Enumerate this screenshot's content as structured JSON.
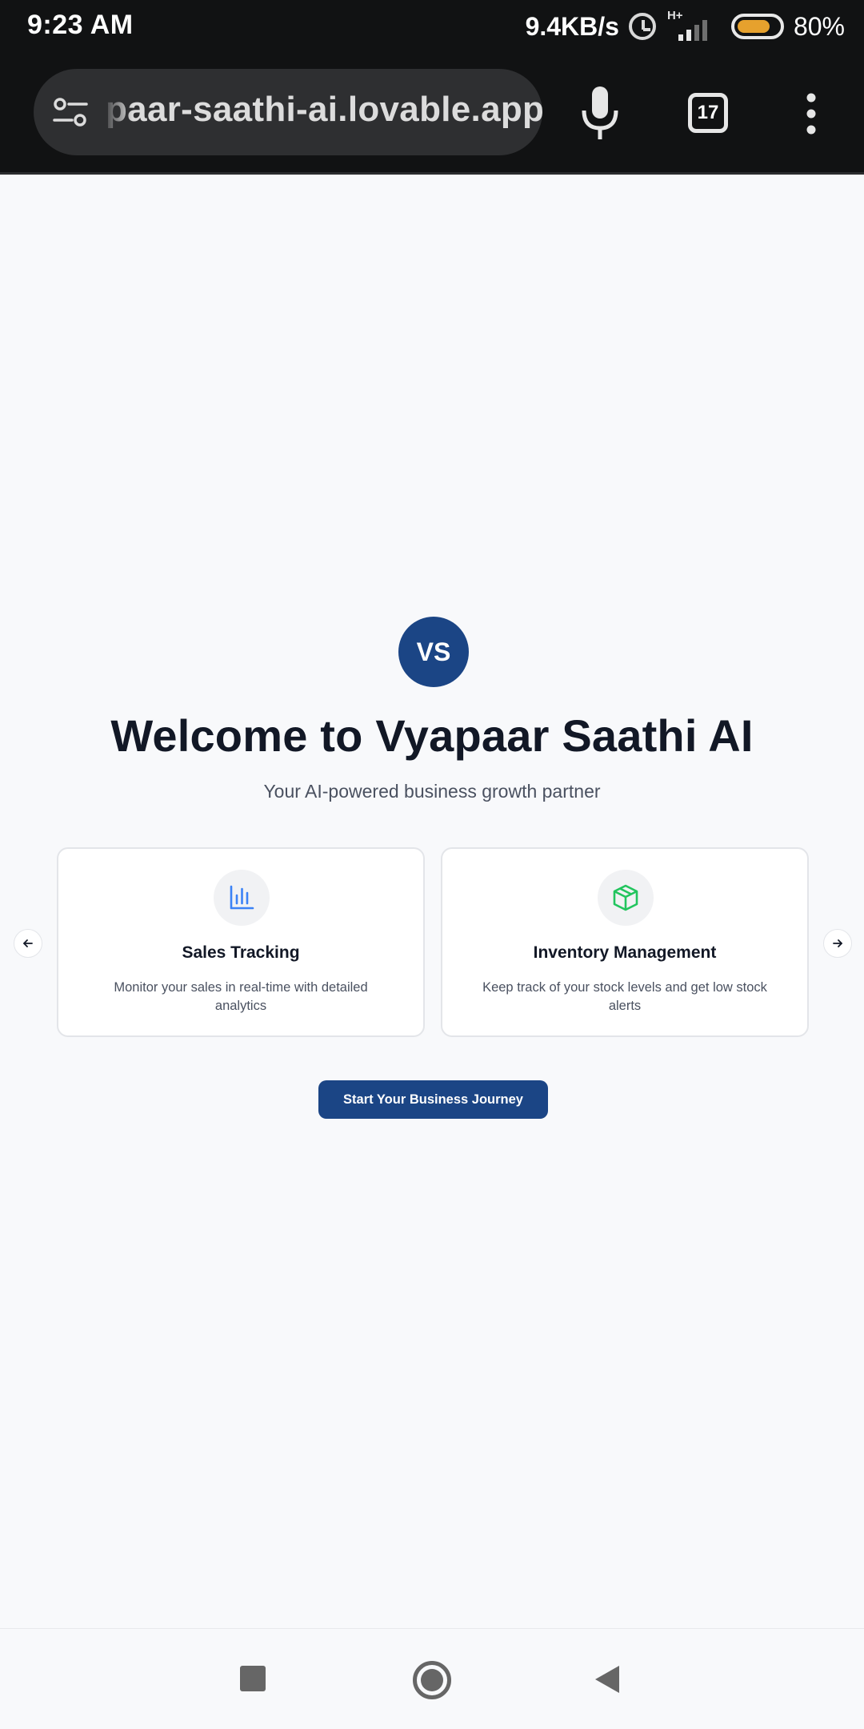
{
  "status_bar": {
    "time": "9:23 AM",
    "net_speed": "9.4KB/s",
    "network_type": "H+",
    "battery_level": 0.8,
    "battery_percent": "80%",
    "icons": [
      "alarm-icon",
      "signal-icon",
      "battery-icon"
    ]
  },
  "browser": {
    "url": "paar-saathi-ai.lovable.app",
    "tab_count": "17",
    "icons": [
      "tune-icon",
      "mic-icon",
      "tabs-icon",
      "more-vert-icon"
    ]
  },
  "hero": {
    "logo_text": "VS",
    "title": "Welcome to Vyapaar Saathi AI",
    "subtitle": "Your AI-powered business growth partner"
  },
  "features": [
    {
      "icon": "bar-chart-icon",
      "title": "Sales Tracking",
      "description": "Monitor your sales in real-time with detailed analytics"
    },
    {
      "icon": "package-icon",
      "title": "Inventory Management",
      "description": "Keep track of your stock levels and get low stock alerts"
    }
  ],
  "carousel": {
    "prev_icon": "arrow-left-icon",
    "next_icon": "arrow-right-icon"
  },
  "cta": {
    "label": "Start Your Business Journey"
  },
  "colors": {
    "brand": "#1b4585",
    "chart_icon": "#3b82f6",
    "package_icon": "#22c55e",
    "battery": "#e6a12d"
  },
  "system_nav": {
    "icons": [
      "recents-icon",
      "home-icon",
      "back-icon"
    ]
  }
}
